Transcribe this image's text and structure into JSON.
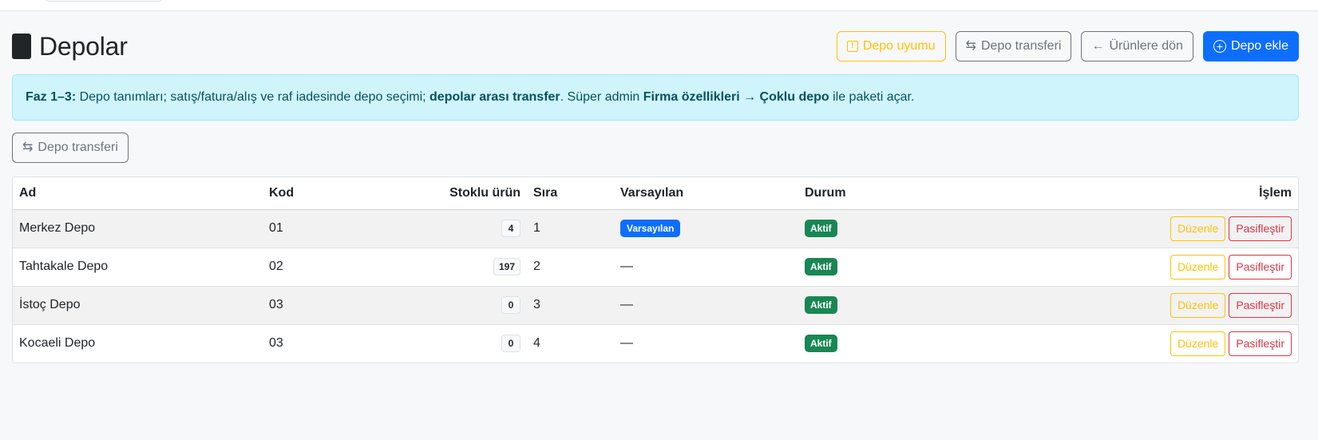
{
  "header": {
    "title": "Depolar",
    "actions": {
      "compat_label": "Depo uyumu",
      "transfer_label": "Depo transferi",
      "back_label": "Ürünlere dön",
      "add_label": "Depo ekle"
    }
  },
  "alert": {
    "phase": "Faz 1–3:",
    "text1": " Depo tanımları; satış/fatura/alış ve raf iadesinde depo seçimi; ",
    "bold1": "depolar arası transfer",
    "text2": ". Süper admin ",
    "bold2": "Firma özellikleri → Çoklu depo",
    "text3": " ile paketi açar."
  },
  "transfer_button_label": "Depo transferi",
  "table": {
    "columns": {
      "name": "Ad",
      "code": "Kod",
      "stock": "Stoklu ürün",
      "order": "Sıra",
      "default": "Varsayılan",
      "status": "Durum",
      "action": "İşlem"
    },
    "rows": [
      {
        "name": "Merkez Depo",
        "code": "01",
        "stock": "4",
        "order": "1",
        "default_badge": "Varsayılan",
        "default_text": "",
        "status": "Aktif",
        "edit": "Düzenle",
        "deactivate": "Pasifleştir"
      },
      {
        "name": "Tahtakale Depo",
        "code": "02",
        "stock": "197",
        "order": "2",
        "default_badge": "",
        "default_text": "—",
        "status": "Aktif",
        "edit": "Düzenle",
        "deactivate": "Pasifleştir"
      },
      {
        "name": "İstoç Depo",
        "code": "03",
        "stock": "0",
        "order": "3",
        "default_badge": "",
        "default_text": "—",
        "status": "Aktif",
        "edit": "Düzenle",
        "deactivate": "Pasifleştir"
      },
      {
        "name": "Kocaeli Depo",
        "code": "03",
        "stock": "0",
        "order": "4",
        "default_badge": "",
        "default_text": "—",
        "status": "Aktif",
        "edit": "Düzenle",
        "deactivate": "Pasifleştir"
      }
    ]
  },
  "icons": {
    "title": "warehouse-icon",
    "compat": "exclamation-square-icon",
    "transfer": "arrows-left-right-icon",
    "back": "arrow-left-icon",
    "add": "plus-circle-icon"
  },
  "colors": {
    "primary": "#0d6efd",
    "warning": "#ffc107",
    "secondary": "#6c757d",
    "success": "#198754",
    "danger": "#dc3545",
    "info_bg": "#cff4fc",
    "info_text": "#055160"
  }
}
